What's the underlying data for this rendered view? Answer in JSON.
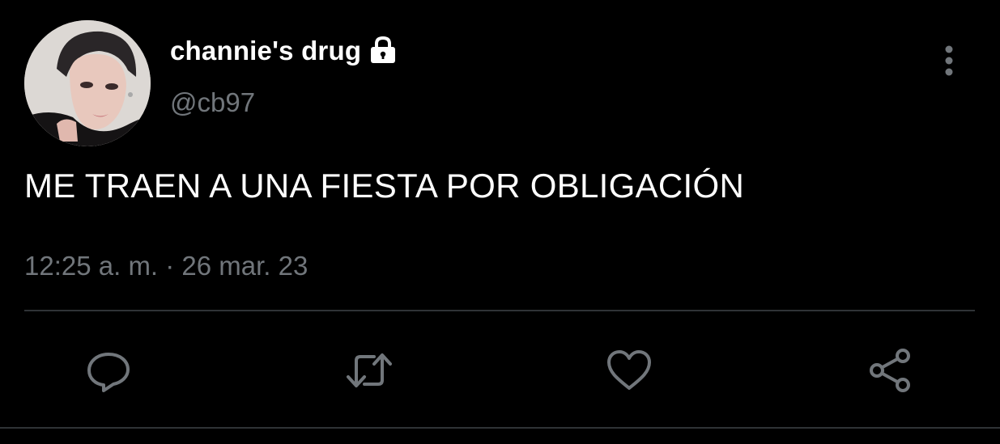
{
  "tweet": {
    "display_name": "channie's drug",
    "handle": "@cb97",
    "text": "ME TRAEN A UNA FIESTA POR OBLIGACIÓN",
    "timestamp": "12:25 a. m. · 26 mar. 23",
    "protected_icon": "lock-icon",
    "avatar": "profile-photo"
  },
  "actions": [
    {
      "name": "reply",
      "icon": "reply-icon"
    },
    {
      "name": "retweet",
      "icon": "retweet-icon"
    },
    {
      "name": "like",
      "icon": "heart-icon"
    },
    {
      "name": "share",
      "icon": "share-icon"
    }
  ],
  "menu": {
    "icon": "more-vertical-icon"
  },
  "colors": {
    "background": "#000000",
    "primary_text": "#ffffff",
    "secondary_text": "#71767b",
    "divider": "#2f3336",
    "icon": "#71767b"
  }
}
